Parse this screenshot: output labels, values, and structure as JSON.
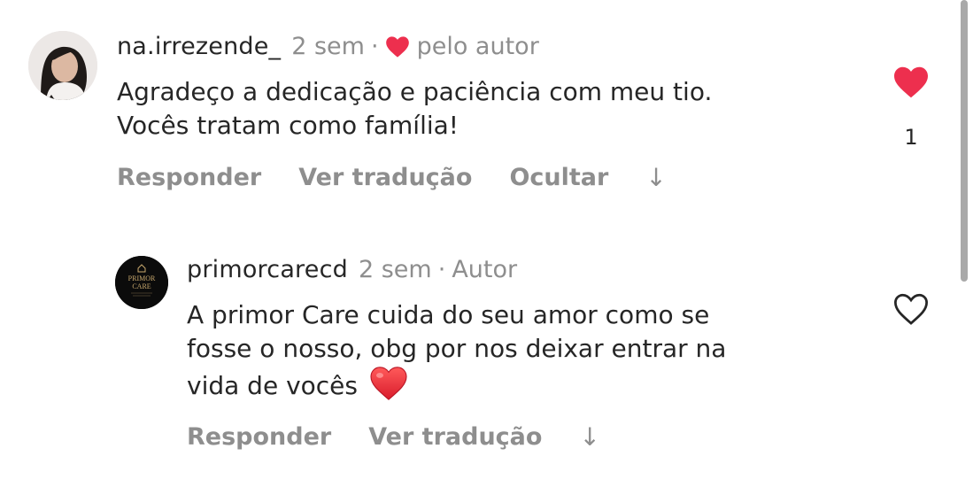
{
  "comments": [
    {
      "username": "na.irrezende_",
      "time": "2 sem",
      "separator": "·",
      "liked_by_author": "pelo autor",
      "text_lines": [
        "Agradeço a dedicação e paciência com meu tio.",
        "Vocês tratam como família!"
      ],
      "actions": {
        "reply": "Responder",
        "translate": "Ver tradução",
        "hide": "Ocultar",
        "arrow": "↓"
      },
      "likes": "1",
      "liked": true,
      "like_color": "#ed2f4e"
    },
    {
      "username": "primorcarecd",
      "time": "2 sem",
      "separator": "·",
      "role": "Autor",
      "avatar_text": [
        "PRIMOR",
        "CARE"
      ],
      "text_lines": [
        "A primor Care cuida do seu amor como se",
        "fosse o nosso, obg por nos  deixar entrar na",
        "vida de vocês"
      ],
      "actions": {
        "reply": "Responder",
        "translate": "Ver tradução",
        "arrow": "↓"
      },
      "liked": false
    }
  ]
}
